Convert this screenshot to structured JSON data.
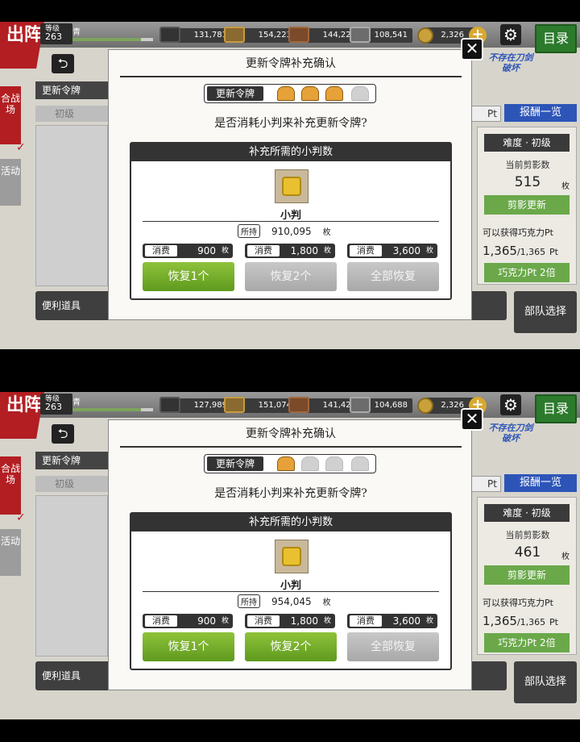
{
  "common": {
    "chu_jin": "出阵",
    "level_label": "等级",
    "player_name": "青",
    "koban_total": "2,326",
    "plus": "+",
    "gear": "⚙",
    "mokuroku": "目录",
    "back": "⮌",
    "side_tab_battle": "合战场",
    "side_tab_event": "活动",
    "check": "✓",
    "token_tab": "更新令牌",
    "difficulty_tab": "初级",
    "pt_label": "Pt",
    "reward_list": "报酬一览",
    "logo_text": "不存在刀剑破坏",
    "difficulty": "难度 · 初级",
    "current_shadow": "当前剪影数",
    "mai": "枚",
    "shadow_refresh": "剪影更新",
    "choco_get": "可以获得巧克力Pt",
    "choco_cur": "1,365",
    "choco_max": "/1,365",
    "pt_small": "Pt",
    "choco_double": "巧克力Pt 2倍",
    "bottom_items": "便利道具",
    "unit_select": "部队选择",
    "dialog": {
      "title": "更新令牌补充确认",
      "close": "✕",
      "token_label": "更新令牌",
      "question": "是否消耗小判来补充更新令牌?",
      "box_head": "补充所需的小判数",
      "item_name": "小判",
      "owned_key": "所持",
      "mai": "枚",
      "cost_key": "消费",
      "costs": [
        "900",
        "1,800",
        "3,600"
      ],
      "buttons": [
        "恢复1个",
        "恢复2个",
        "全部恢复"
      ]
    }
  },
  "panels": [
    {
      "level": "263",
      "xp_fraction": 0.85,
      "resources": [
        "131,781",
        "154,223",
        "144,222",
        "108,541"
      ],
      "tokens_filled": 3,
      "tokens_total": 4,
      "shadow_count": "515",
      "owned_koban": "910,095",
      "button_enabled": [
        true,
        false,
        false
      ]
    },
    {
      "level": "263",
      "xp_fraction": 0.85,
      "resources": [
        "127,989",
        "151,074",
        "141,421",
        "104,688"
      ],
      "tokens_filled": 1,
      "tokens_total": 4,
      "shadow_count": "461",
      "owned_koban": "954,045",
      "button_enabled": [
        true,
        true,
        false
      ]
    }
  ]
}
